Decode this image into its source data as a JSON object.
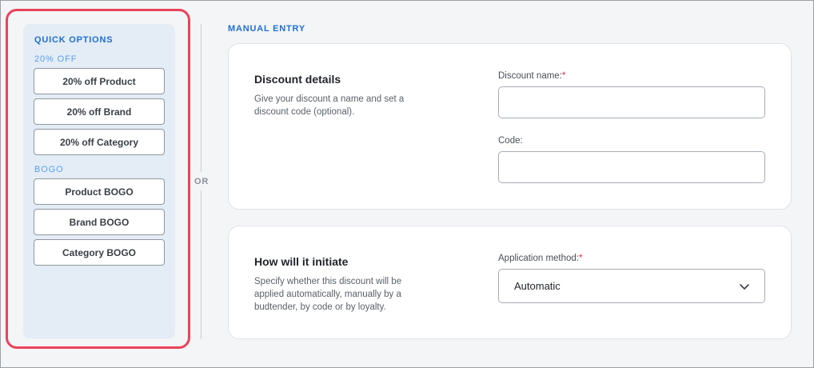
{
  "quick_options": {
    "title": "QUICK OPTIONS",
    "groups": [
      {
        "label": "20% OFF",
        "buttons": [
          "20% off Product",
          "20% off Brand",
          "20% off Category"
        ]
      },
      {
        "label": "BOGO",
        "buttons": [
          "Product BOGO",
          "Brand BOGO",
          "Category BOGO"
        ]
      }
    ],
    "highlight_color": "#e8445a"
  },
  "divider": {
    "label": "OR"
  },
  "manual_entry": {
    "title": "MANUAL ENTRY",
    "discount_details": {
      "heading": "Discount details",
      "description": "Give your discount a name and set a discount code (optional).",
      "name_label": "Discount name:",
      "name_required": "*",
      "name_value": "",
      "code_label": "Code:",
      "code_value": ""
    },
    "initiate": {
      "heading": "How will it initiate",
      "description": "Specify whether this discount will be applied automatically, manually by a budtender, by code or by loyalty.",
      "method_label": "Application method:",
      "method_required": "*",
      "method_value": "Automatic",
      "method_icon": "chevron-down-icon"
    }
  },
  "colors": {
    "accent": "#1f6fd1",
    "group_label": "#5aa0ef",
    "required": "#e0283f",
    "panel_bg": "#e4ecf6"
  }
}
